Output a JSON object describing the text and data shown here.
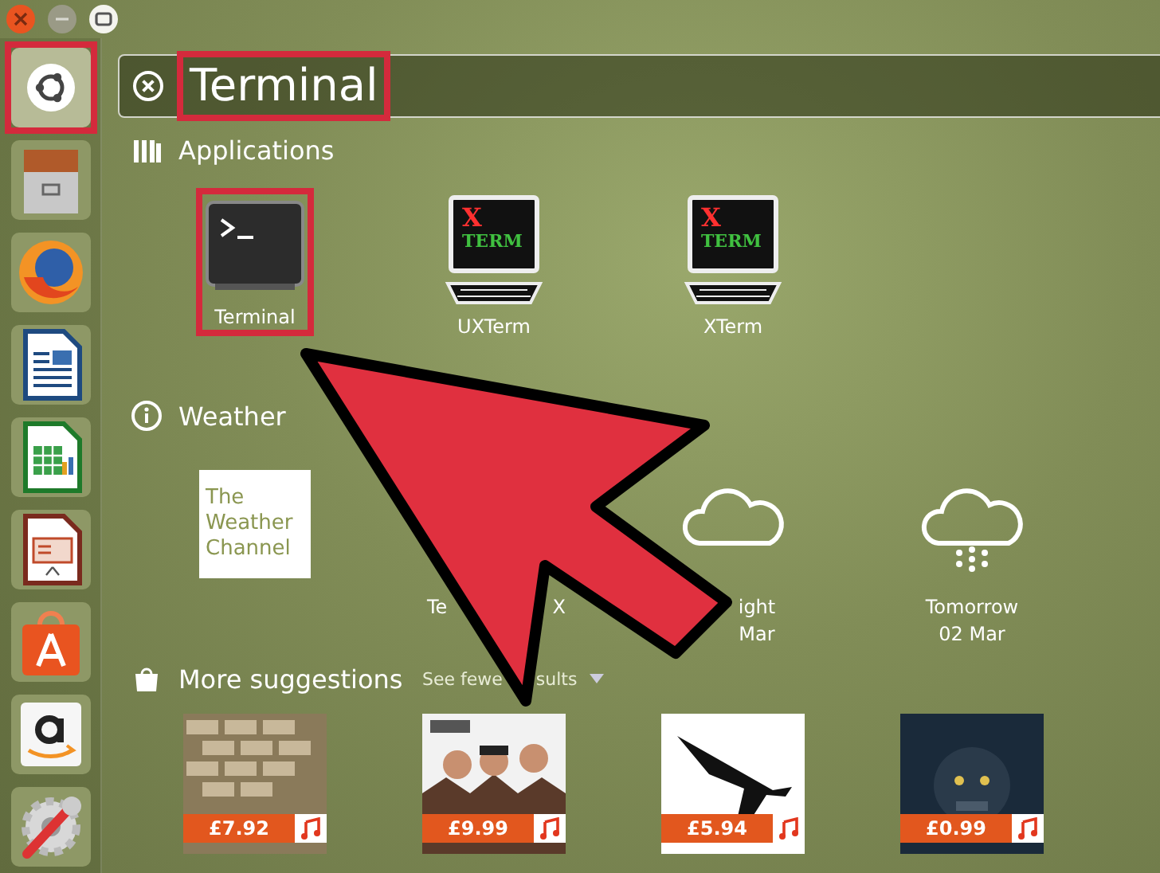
{
  "window_controls": [
    {
      "kind": "close"
    },
    {
      "kind": "minimize"
    },
    {
      "kind": "maximize"
    }
  ],
  "launcher": {
    "items": [
      {
        "kind": "dash",
        "highlighted": true
      },
      {
        "kind": "files",
        "highlighted": false
      },
      {
        "kind": "browser",
        "highlighted": false
      },
      {
        "kind": "writer",
        "highlighted": false
      },
      {
        "kind": "calc",
        "highlighted": false
      },
      {
        "kind": "impress",
        "highlighted": false
      },
      {
        "kind": "software",
        "highlighted": false
      },
      {
        "kind": "shop",
        "highlighted": false
      },
      {
        "kind": "settings",
        "highlighted": false
      }
    ]
  },
  "search": {
    "value": "Terminal",
    "highlighted": true
  },
  "applications": {
    "title": "Applications",
    "items": [
      {
        "kind": "terminal",
        "label": "Terminal",
        "highlighted": true
      },
      {
        "kind": "xterm",
        "label": "UXTerm",
        "icon_text": [
          "X",
          "TERM"
        ],
        "highlighted": false
      },
      {
        "kind": "xterm",
        "label": "XTerm",
        "icon_text": [
          "X",
          "TERM"
        ],
        "highlighted": false
      }
    ]
  },
  "weather": {
    "title": "Weather",
    "items": [
      {
        "kind": "logo",
        "logo_text": [
          "The",
          "Weather",
          "Channel"
        ]
      },
      {
        "kind": "partial",
        "lines": [
          "Te",
          "X"
        ]
      },
      {
        "kind": "cloud",
        "lines": [
          "ight",
          "Mar"
        ]
      },
      {
        "kind": "rain",
        "lines": [
          "Tomorrow",
          "02 Mar"
        ]
      }
    ]
  },
  "suggestions": {
    "title": "More suggestions",
    "toggle_start": "See fewe",
    "toggle_end": "sults",
    "items": [
      {
        "price": "£7.92"
      },
      {
        "price": "£9.99"
      },
      {
        "price": "£5.94"
      },
      {
        "price": "£0.99"
      }
    ]
  },
  "annotation": {
    "kind": "arrow"
  }
}
